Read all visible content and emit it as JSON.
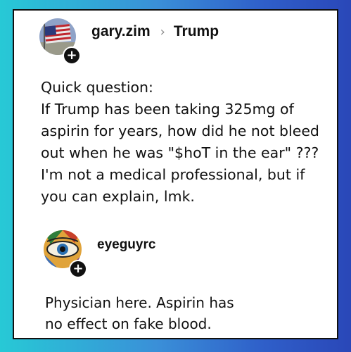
{
  "post": {
    "author": "gary.zim",
    "separator": "›",
    "community": "Trump",
    "follow_label": "+",
    "lines": [
      "Quick question:",
      "If Trump has been taking 325mg of",
      "aspirin for years, how did he not bleed",
      "out when he was \"$hoT in the ear\" ???",
      "I'm not a medical professional, but if",
      "you can explain, lmk."
    ]
  },
  "comment": {
    "author": "eyeguyrc",
    "follow_label": "+",
    "lines": [
      "Physician here. Aspirin has",
      "no effect on fake blood."
    ]
  },
  "colors": {
    "background_left": "#27c9d6",
    "background_right": "#2a47b8",
    "card": "#ffffff",
    "text": "#111111"
  }
}
